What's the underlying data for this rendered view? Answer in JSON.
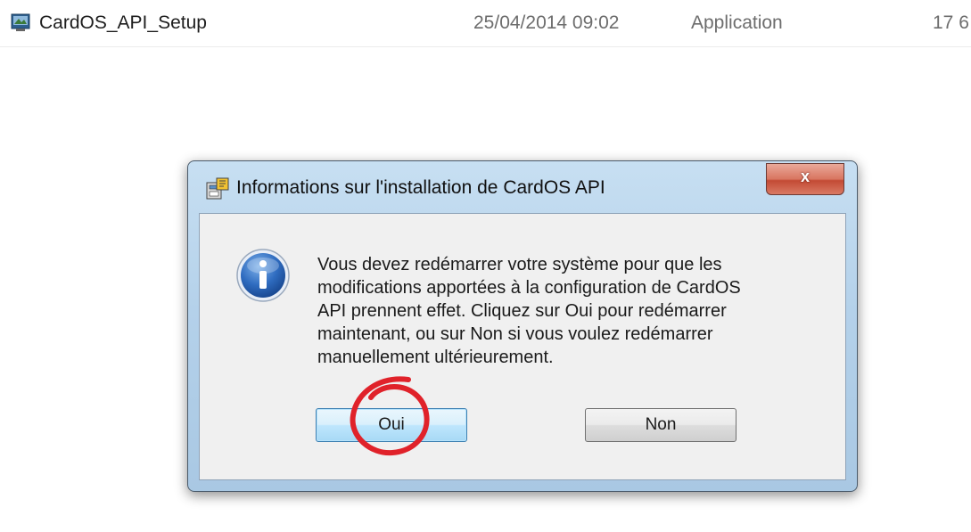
{
  "file_row": {
    "name": "CardOS_API_Setup",
    "date": "25/04/2014 09:02",
    "type": "Application",
    "size": "17 6",
    "icon": "installer-icon"
  },
  "dialog": {
    "title": "Informations sur l'installation de CardOS API",
    "title_icon": "setup-icon",
    "close_label": "x",
    "info_icon": "info-icon",
    "message_lines": [
      "Vous devez redémarrer votre système pour que les",
      "modifications apportées à la configuration de CardOS",
      "API prennent effet. Cliquez sur Oui pour redémarrer",
      "maintenant, ou sur Non si vous voulez redémarrer",
      "manuellement ultérieurement."
    ],
    "buttons": {
      "yes": "Oui",
      "no": "Non"
    }
  },
  "annotation": {
    "shape": "red-circle",
    "color": "#e0222a",
    "target": "yes"
  },
  "colors": {
    "dialog_frame": "#b4d1ea",
    "close_button": "#d97560",
    "default_button_border": "#3c7fb1"
  }
}
